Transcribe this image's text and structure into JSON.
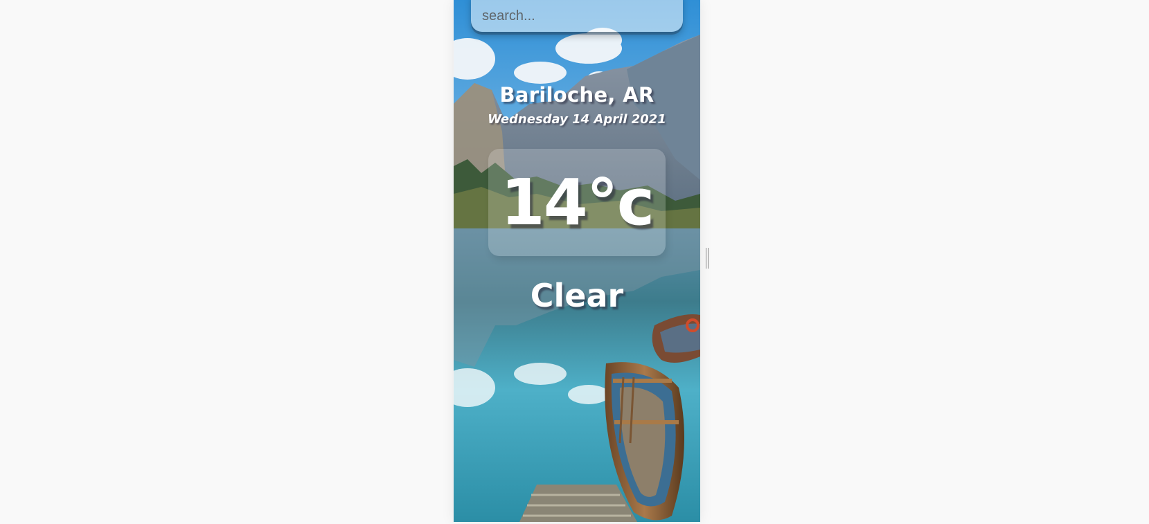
{
  "search": {
    "placeholder": "search...",
    "value": ""
  },
  "location": {
    "city": "Bariloche, AR"
  },
  "date": "Wednesday 14 April 2021",
  "weather": {
    "temperature": "14°c",
    "condition": "Clear"
  },
  "background_image": {
    "description_icon": "mountain-lake-boats-photo"
  },
  "colors": {
    "page_background": "#f9f9f9",
    "text": "#ffffff"
  }
}
